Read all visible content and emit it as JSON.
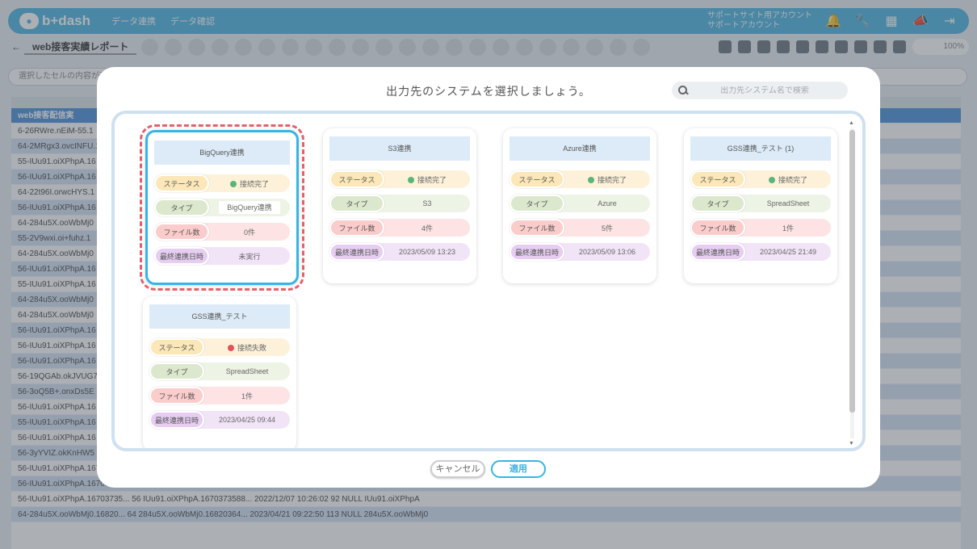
{
  "app": {
    "logo": "b+dash",
    "nav": [
      "データ連携",
      "データ確認"
    ],
    "account_line1": "サポートサイト用アカウント",
    "account_line2": "サポートアカウント",
    "report_name": "web接客実績レポート",
    "zoom": "100%",
    "formula_placeholder": "選択したセルの内容が表示されます"
  },
  "grid": {
    "col_a": "A",
    "sheet_title": "web接客配信実",
    "rows": [
      "6-26RWre.nEiM-55.1",
      "64-2MRgx3.ovcINFU.1",
      "55-IUu91.oiXPhpA.16",
      "56-IUu91.oiXPhpA.16",
      "64-22t96I.orwcHYS.1",
      "56-IUu91.oiXPhpA.16",
      "64-284u5X.ooWbMj0",
      "55-2V9wxi.oi+fuhz.1",
      "64-284u5X.ooWbMj0",
      "56-IUu91.oiXPhpA.16",
      "55-IUu91.oiXPhpA.16",
      "64-284u5X.ooWbMj0",
      "64-284u5X.ooWbMj0",
      "56-IUu91.oiXPhpA.16",
      "56-IUu91.oiXPhpA.16",
      "56-IUu91.oiXPhpA.16",
      "56-19QGAb.okJVUG7",
      "56-3oQ5B+.onxDs5E",
      "56-IUu91.oiXPhpA.16",
      "55-IUu91.oiXPhpA.16",
      "56-IUu91.oiXPhpA.16",
      "56-3yYVIZ.okKnHW5",
      "56-IUu91.oiXPhpA.16703735...    56    IUu91.oiXPhpA.1670373588...    2022/12/07 10:26:07    94    NULL    IUu91.oiXPhpA",
      "56-IUu91.oiXPhpA.16703145...    56    IUu91.oiXPhpA.1670314543...    2022/12/06 17:15:47    93    NULL    IUu91.oiXPhpA",
      "56-IUu91.oiXPhpA.16703735...    56    IUu91.oiXPhpA.1670373588...    2022/12/07 10:26:02    92    NULL    IUu91.oiXPhpA",
      "64-284u5X.ooWbMj0.16820...    64    284u5X.ooWbMj0.16820364...    2023/04/21 09:22:50    113    NULL    284u5X.ooWbMj0"
    ]
  },
  "modal": {
    "title": "出力先のシステムを選択しましょう。",
    "search_placeholder": "出力先システム名で検索",
    "labels": {
      "status": "ステータス",
      "type": "タイプ",
      "files": "ファイル数",
      "last_sync": "最終連携日時"
    },
    "cards": [
      {
        "title": "BigQuery連携",
        "status": "接続完了",
        "status_ok": true,
        "type": "BigQuery連携",
        "files": "0件",
        "last_sync": "未実行",
        "selected": true
      },
      {
        "title": "S3連携",
        "status": "接続完了",
        "status_ok": true,
        "type": "S3",
        "files": "4件",
        "last_sync": "2023/05/09 13:23",
        "selected": false
      },
      {
        "title": "Azure連携",
        "status": "接続完了",
        "status_ok": true,
        "type": "Azure",
        "files": "5件",
        "last_sync": "2023/05/09 13:06",
        "selected": false
      },
      {
        "title": "GSS連携_テスト (1)",
        "status": "接続完了",
        "status_ok": true,
        "type": "SpreadSheet",
        "files": "1件",
        "last_sync": "2023/04/25 21:49",
        "selected": false
      },
      {
        "title": "GSS連携_テスト",
        "status": "接続失敗",
        "status_ok": false,
        "type": "SpreadSheet",
        "files": "1件",
        "last_sync": "2023/04/25 09:44",
        "selected": false
      }
    ],
    "cancel_label": "キャンセル",
    "apply_label": "適用"
  },
  "colors": {
    "accent": "#34b5e6",
    "selected_outline": "#e5606a",
    "ok": "#5bb57a",
    "ng": "#e5505a"
  }
}
